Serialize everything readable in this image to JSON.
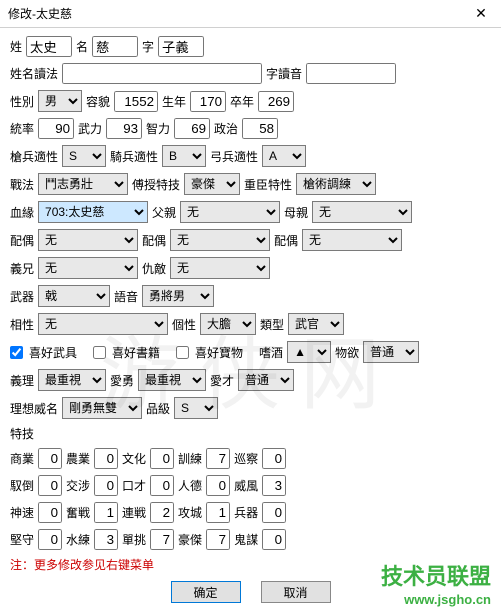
{
  "title": "修改-太史慈",
  "row1": {
    "surname_lbl": "姓",
    "surname": "太史",
    "given_lbl": "名",
    "given": "慈",
    "courtesy_lbl": "字",
    "courtesy": "子義"
  },
  "row2": {
    "name_reading_lbl": "姓名讀法",
    "name_reading": "",
    "courtesy_reading_lbl": "字讀音",
    "courtesy_reading": ""
  },
  "row3": {
    "gender_lbl": "性別",
    "gender": "男",
    "appearance_lbl": "容貌",
    "appearance": "1552",
    "birth_lbl": "生年",
    "birth": "170",
    "death_lbl": "卒年",
    "death": "269"
  },
  "row4": {
    "lead_lbl": "統率",
    "lead": "90",
    "war_lbl": "武力",
    "war": "93",
    "int_lbl": "智力",
    "int": "69",
    "pol_lbl": "政治",
    "pol": "58"
  },
  "row5": {
    "spear_lbl": "槍兵適性",
    "spear": "S",
    "cav_lbl": "騎兵適性",
    "cav": "B",
    "bow_lbl": "弓兵適性",
    "bow": "A"
  },
  "row6": {
    "tactic_lbl": "戰法",
    "tactic": "鬥志勇壯",
    "teach_lbl": "傅授特技",
    "teach": "豪傑",
    "heavy_lbl": "重臣特性",
    "heavy": "槍術調練"
  },
  "row7": {
    "blood_lbl": "血緣",
    "blood": "703:太史慈",
    "father_lbl": "父親",
    "father": "无",
    "mother_lbl": "母親",
    "mother": "无"
  },
  "row8": {
    "spouse_lbl": "配偶",
    "spouse1": "无",
    "spouse2": "无",
    "spouse3": "无"
  },
  "row9": {
    "sworn_lbl": "義兄",
    "sworn": "无",
    "enemy_lbl": "仇敵",
    "enemy": "无"
  },
  "row10": {
    "weapon_lbl": "武器",
    "weapon": "戟",
    "voice_lbl": "語音",
    "voice": "勇將男"
  },
  "row11": {
    "affinity_lbl": "相性",
    "affinity": "无",
    "person_lbl": "個性",
    "person": "大膽",
    "type_lbl": "類型",
    "type": "武官"
  },
  "row12": {
    "like_wu_lbl": "喜好武具",
    "like_book_lbl": "喜好書籍",
    "like_treasure_lbl": "喜好寶物",
    "wine_lbl": "嗜酒",
    "wine": "▲",
    "desire_lbl": "物欲",
    "desire": "普通"
  },
  "row13": {
    "yili_lbl": "義理",
    "yili": "最重視",
    "aiyong_lbl": "愛勇",
    "aiyong": "最重視",
    "aicai_lbl": "愛才",
    "aicai": "普通"
  },
  "row14": {
    "ideal_lbl": "理想威名",
    "ideal": "剛勇無雙",
    "rank_lbl": "品級",
    "rank": "S"
  },
  "row15": {
    "skill_lbl": "特技"
  },
  "row16": {
    "s1_lbl": "商業",
    "s1": "0",
    "s2_lbl": "農業",
    "s2": "0",
    "s3_lbl": "文化",
    "s3": "0",
    "s4_lbl": "訓練",
    "s4": "7",
    "s5_lbl": "巡察",
    "s5": "0"
  },
  "row17": {
    "s1_lbl": "馭倒",
    "s1": "0",
    "s2_lbl": "交涉",
    "s2": "0",
    "s3_lbl": "口才",
    "s3": "0",
    "s4_lbl": "人德",
    "s4": "0",
    "s5_lbl": "威風",
    "s5": "3"
  },
  "row18": {
    "s1_lbl": "神速",
    "s1": "0",
    "s2_lbl": "奮戦",
    "s2": "1",
    "s3_lbl": "連戦",
    "s3": "2",
    "s4_lbl": "攻城",
    "s4": "1",
    "s5_lbl": "兵器",
    "s5": "0"
  },
  "row19": {
    "s1_lbl": "堅守",
    "s1": "0",
    "s2_lbl": "水練",
    "s2": "3",
    "s3_lbl": "單挑",
    "s3": "7",
    "s4_lbl": "豪傑",
    "s4": "7",
    "s5_lbl": "鬼謀",
    "s5": "0"
  },
  "note": "注：更多修改参见右键菜单",
  "ok_btn": "确定",
  "cancel_btn": "取消",
  "wm1": "游侠网",
  "wm2": "技术员联盟",
  "wm3": "www.jsgho.cn"
}
